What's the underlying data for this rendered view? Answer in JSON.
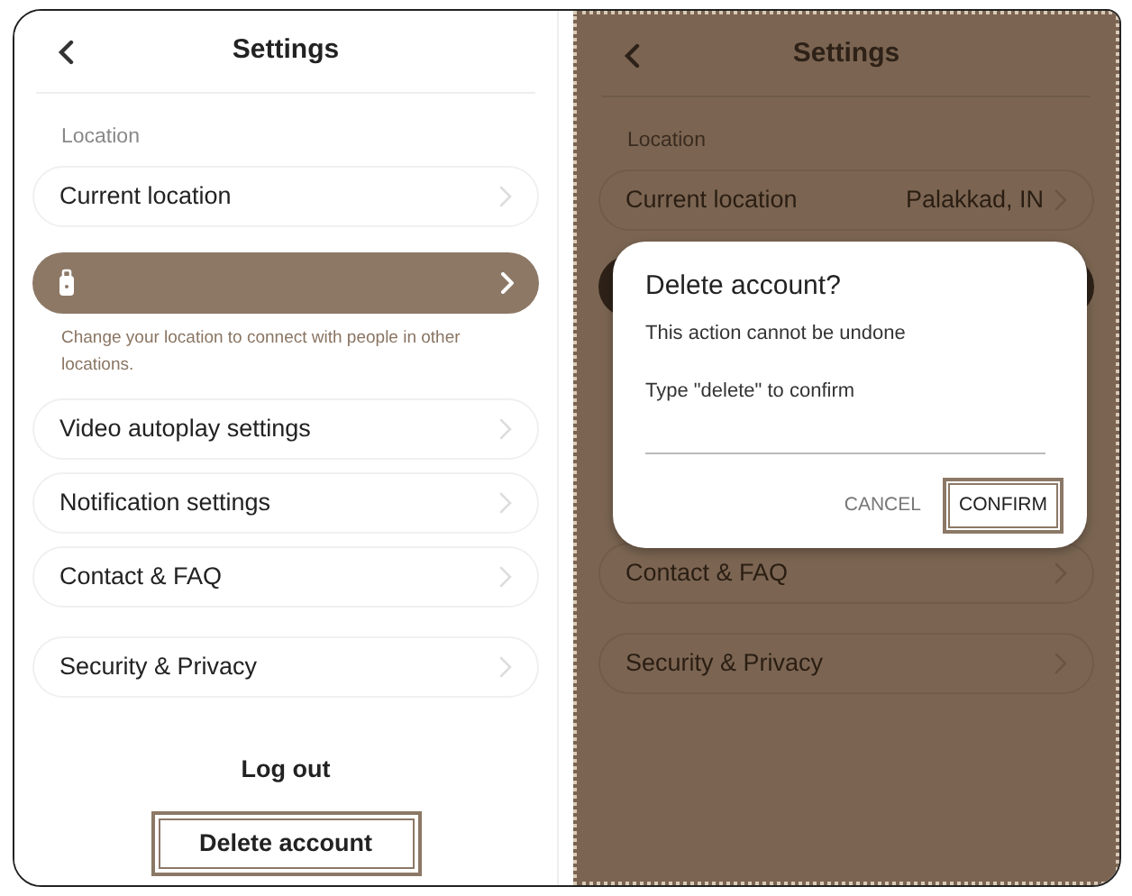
{
  "left_screen": {
    "title": "Settings",
    "section_label": "Location",
    "items": [
      {
        "kind": "row",
        "label": "Current location"
      },
      {
        "kind": "highlight",
        "note": "Change your location to connect with people in other locations."
      },
      {
        "kind": "row",
        "label": "Video autoplay settings"
      },
      {
        "kind": "row",
        "label": "Notification settings"
      },
      {
        "kind": "row",
        "label": "Contact & FAQ"
      },
      {
        "kind": "row",
        "label": "Security & Privacy",
        "gap": true
      }
    ],
    "logout": "Log out",
    "delete_button": {
      "label": "Delete account",
      "highlighted": true
    }
  },
  "right_screen": {
    "title": "Settings",
    "section_label": "Location",
    "top_items": [
      {
        "kind": "row",
        "label": "Current location",
        "value": "Palakkad, IN"
      }
    ],
    "bottom_items": [
      {
        "kind": "row",
        "label": "Contact & FAQ"
      },
      {
        "kind": "row",
        "label": "Security & Privacy",
        "gap": true
      }
    ],
    "dialog": {
      "title": "Delete account?",
      "message": "This action cannot be undone",
      "prompt": "Type \"delete\" to confirm",
      "buttons": [
        {
          "label": "CANCEL",
          "highlighted": false
        },
        {
          "label": "CONFIRM",
          "highlighted": true
        }
      ]
    }
  }
}
